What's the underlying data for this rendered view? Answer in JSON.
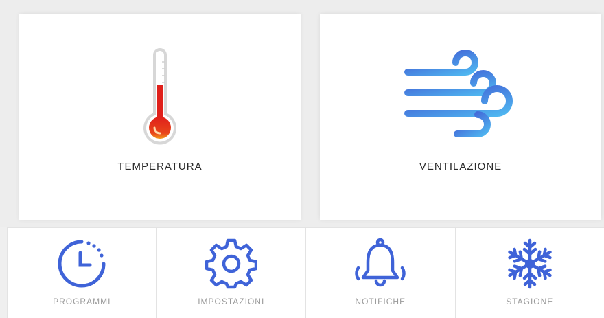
{
  "cards": {
    "temperature": {
      "label": "TEMPERATURA",
      "icon": "thermometer-icon"
    },
    "ventilation": {
      "label": "VENTILAZIONE",
      "icon": "wind-icon"
    }
  },
  "tiles": [
    {
      "label": "PROGRAMMI",
      "icon": "clock-icon"
    },
    {
      "label": "IMPOSTAZIONI",
      "icon": "gear-icon"
    },
    {
      "label": "NOTIFICHE",
      "icon": "bell-icon"
    },
    {
      "label": "STAGIONE",
      "icon": "snowflake-icon"
    }
  ],
  "colors": {
    "accent_blue": "#3f63d8",
    "accent_light_blue": "#4fb6f0",
    "thermo_red": "#e0201b",
    "thermo_orange": "#f39a1a",
    "label_dark": "#2b2b2b",
    "label_grey": "#9a9a9a"
  }
}
